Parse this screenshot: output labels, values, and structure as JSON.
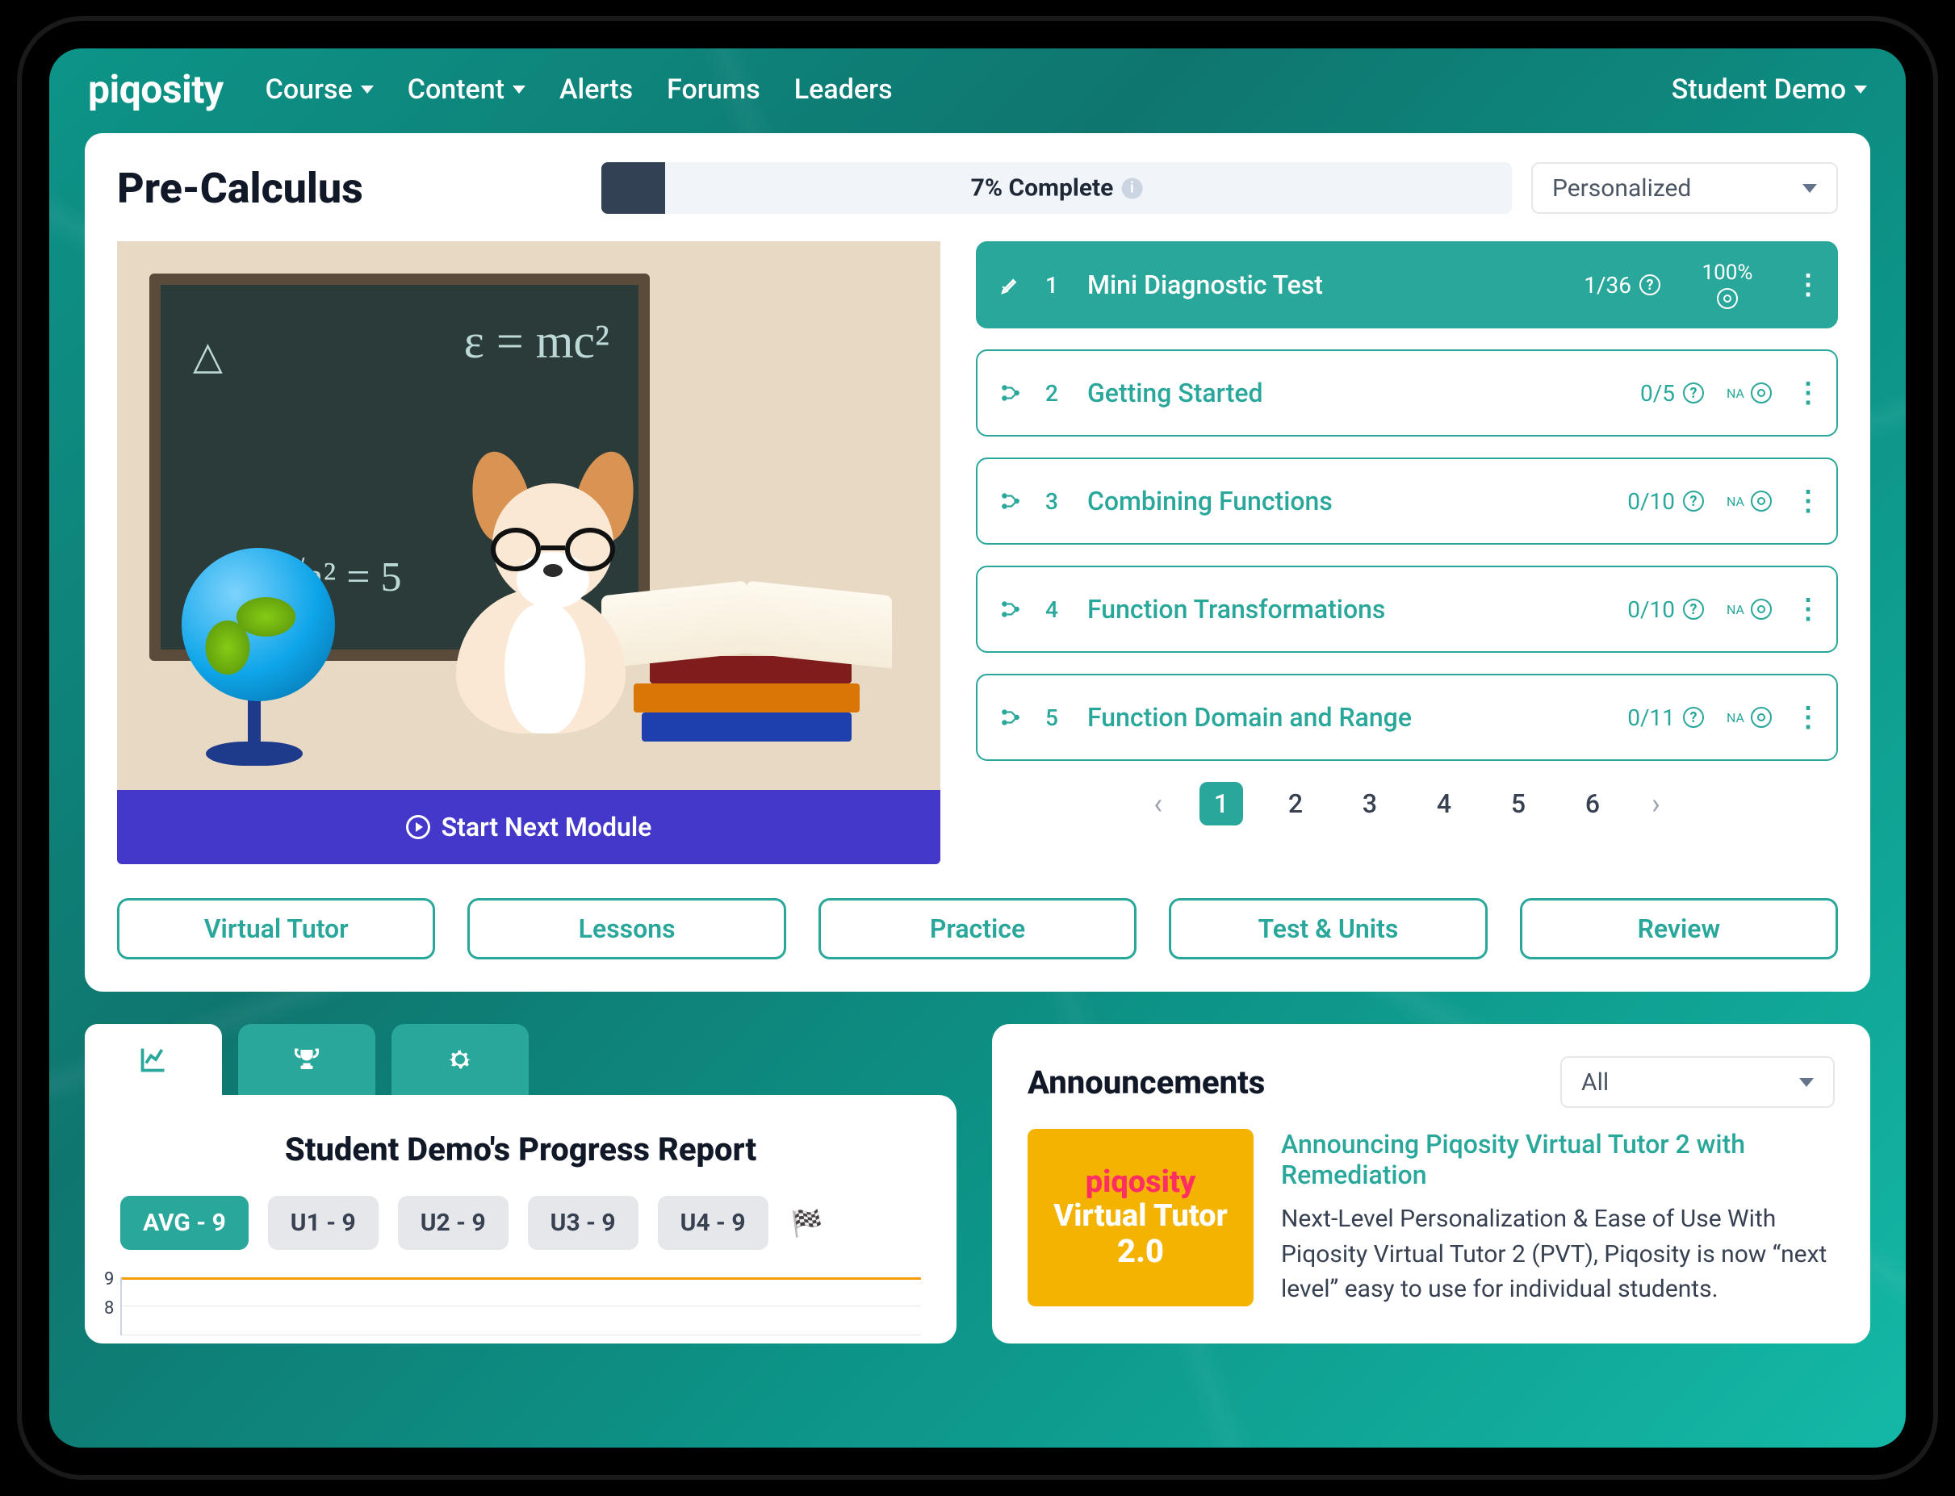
{
  "nav": {
    "brand": "piqosity",
    "items": [
      "Course",
      "Content",
      "Alerts",
      "Forums",
      "Leaders"
    ],
    "items_caret": [
      true,
      true,
      false,
      false,
      false
    ],
    "user": "Student Demo"
  },
  "course": {
    "title": "Pre-Calculus",
    "progress_pct": 7,
    "progress_label": "7% Complete",
    "mode_select": "Personalized",
    "cta": "Start Next Module"
  },
  "modules": [
    {
      "n": "1",
      "title": "Mini Diagnostic Test",
      "frac": "1/36",
      "score": "100%",
      "active": true,
      "icon": "pencil"
    },
    {
      "n": "2",
      "title": "Getting Started",
      "frac": "0/5",
      "score": "NA",
      "active": false,
      "icon": "branch"
    },
    {
      "n": "3",
      "title": "Combining Functions",
      "frac": "0/10",
      "score": "NA",
      "active": false,
      "icon": "branch"
    },
    {
      "n": "4",
      "title": "Function Transformations",
      "frac": "0/10",
      "score": "NA",
      "active": false,
      "icon": "branch"
    },
    {
      "n": "5",
      "title": "Function Domain and Range",
      "frac": "0/11",
      "score": "NA",
      "active": false,
      "icon": "branch"
    }
  ],
  "pager": {
    "pages": [
      "1",
      "2",
      "3",
      "4",
      "5",
      "6"
    ],
    "active": "1"
  },
  "actions": [
    "Virtual Tutor",
    "Lessons",
    "Practice",
    "Test & Units",
    "Review"
  ],
  "report": {
    "title": "Student Demo's Progress Report",
    "pills": [
      {
        "label": "AVG - 9",
        "active": true
      },
      {
        "label": "U1 - 9",
        "active": false
      },
      {
        "label": "U2 - 9",
        "active": false
      },
      {
        "label": "U3 - 9",
        "active": false
      },
      {
        "label": "U4 - 9",
        "active": false
      }
    ],
    "y_labels": [
      "9",
      "8"
    ]
  },
  "announcements": {
    "header": "Announcements",
    "filter": "All",
    "thumb_lines": [
      "piqosity",
      "Virtual Tutor",
      "2.0"
    ],
    "link": "Announcing Piqosity Virtual Tutor 2 with Remediation",
    "desc": "Next-Level Personalization & Ease of Use With Piqosity Virtual Tutor 2 (PVT), Piqosity is now “next level” easy to use for individual students."
  },
  "colors": {
    "teal": "#2aa79b",
    "indigo": "#4338ca",
    "amber": "#f5b301"
  }
}
